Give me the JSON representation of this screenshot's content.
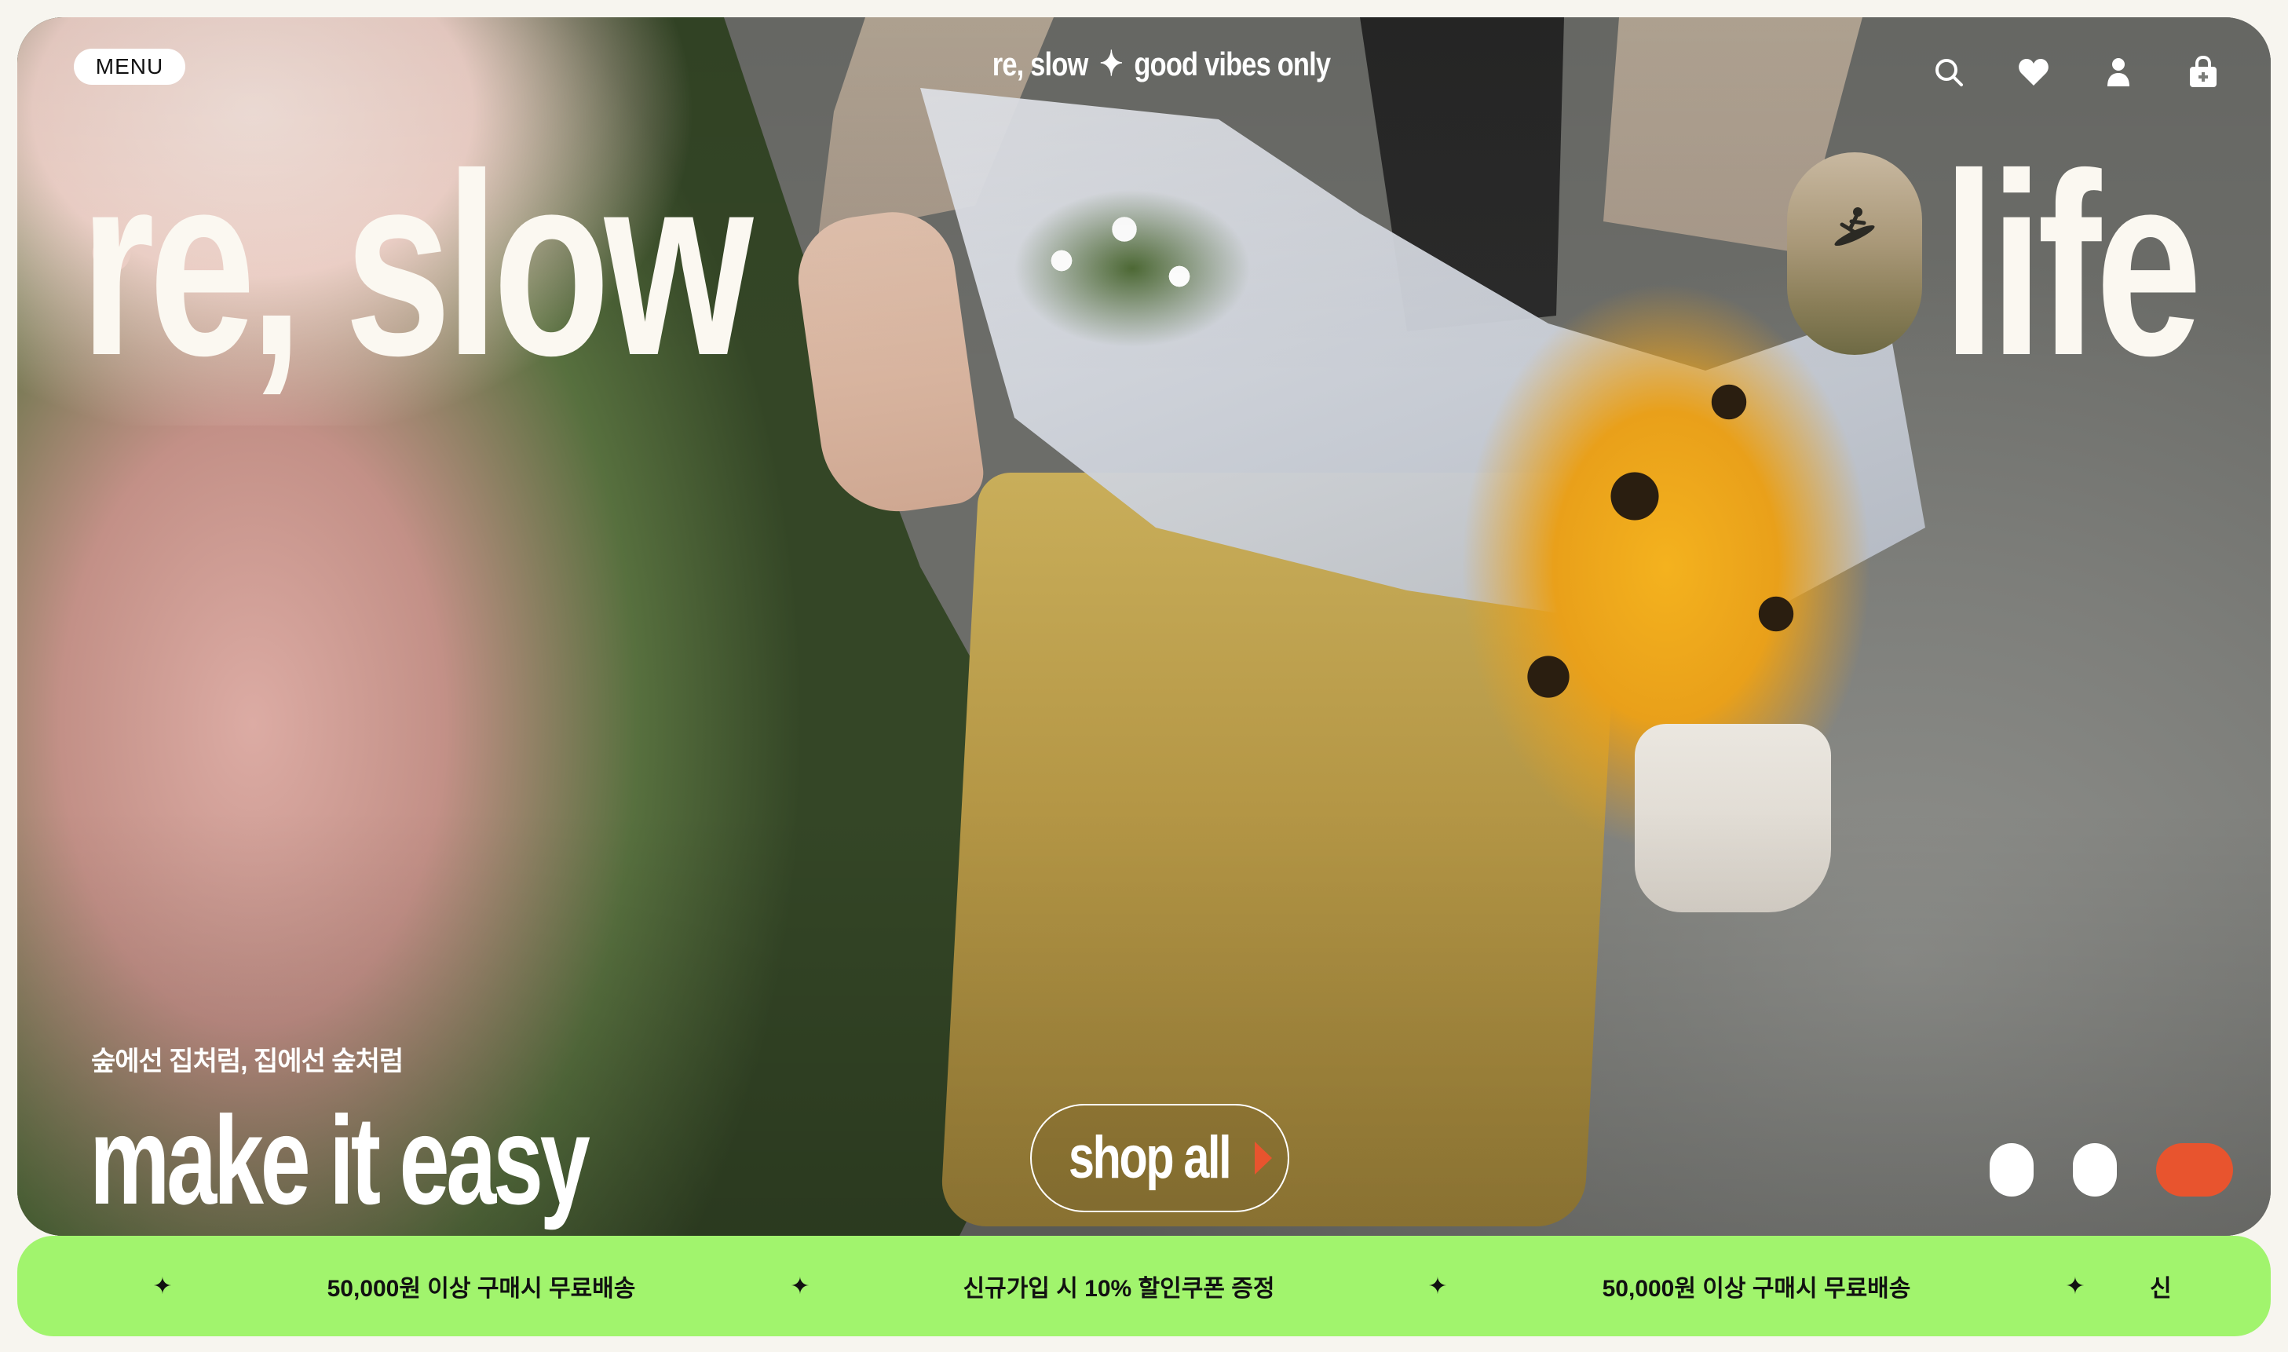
{
  "header": {
    "menu_label": "MENU",
    "tagline_left": "re, slow",
    "tagline_star": "✦",
    "tagline_right": "good vibes only",
    "icons": [
      "search-icon",
      "heart-icon",
      "user-icon",
      "cart-icon"
    ]
  },
  "hero": {
    "title_left": "re, slow",
    "title_right": "life",
    "subtitle": "숲에선 집처럼, 집에선 숲처럼",
    "headline": "make it easy",
    "cta_label": "shop all",
    "slides": {
      "count": 3,
      "active": 3
    }
  },
  "marquee": {
    "star": "✦",
    "items": [
      "50,000원 이상 구매시 무료배송",
      "신규가입 시 10% 할인쿠폰 증정",
      "50,000원 이상 구매시 무료배송",
      "신"
    ]
  },
  "colors": {
    "accent": "#e8542e",
    "marquee_bg": "#a1f46d",
    "text_light": "#fbf8f1",
    "page_bg": "#f7f5ef"
  }
}
